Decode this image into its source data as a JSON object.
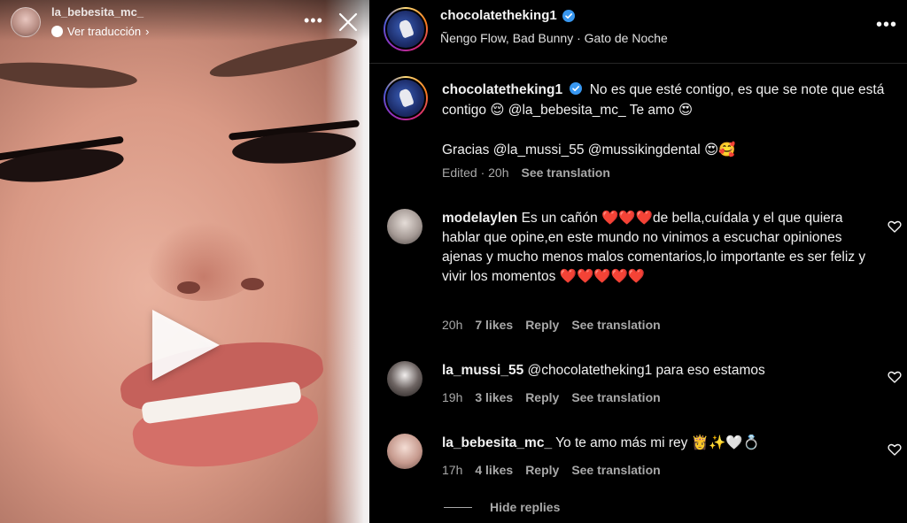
{
  "story": {
    "username": "la_bebesita_mc_",
    "translate_label": "Ver traducción",
    "translate_chevron": "›",
    "more_dots": "•••",
    "play_icon": "play-icon",
    "close_icon": "close-icon"
  },
  "post": {
    "username": "chocolatetheking1",
    "verified_color": "#3897f0",
    "audio_subtitle": "Ñengo Flow, Bad Bunny · Gato de Noche",
    "more_label": "•••"
  },
  "caption": {
    "username": "chocolatetheking1",
    "line1": "No es que esté contigo, es que se note que está contigo 😌 @la_bebesita_mc_  Te amo 😍",
    "line2": "Gracias @la_mussi_55 @mussikingdental 😍🥰",
    "edited": "Edited · 20h",
    "see_translation": "See translation"
  },
  "comments": [
    {
      "username": "modelaylen",
      "text": "Es un cañón ❤️❤️❤️de bella,cuídala y el que quiera hablar que opine,en este mundo no vinimos a escuchar opiniones ajenas y mucho menos malos comentarios,lo importante es ser feliz y vivir los momentos ❤️❤️❤️❤️❤️",
      "time": "20h",
      "likes": "7 likes",
      "reply": "Reply",
      "see_translation": "See translation"
    },
    {
      "username": "la_mussi_55",
      "text": "@chocolatetheking1 para eso estamos",
      "time": "19h",
      "likes": "3 likes",
      "reply": "Reply",
      "see_translation": "See translation"
    },
    {
      "username": "la_bebesita_mc_",
      "text": "Yo te amo más mi rey 👸✨🤍💍",
      "time": "17h",
      "likes": "4 likes",
      "reply": "Reply",
      "see_translation": "See translation"
    }
  ],
  "hide_replies": "Hide replies",
  "colors": {
    "background": "#000000",
    "text_primary": "#f5f5f5",
    "text_secondary": "#a8a8a8",
    "divider": "#262626"
  }
}
